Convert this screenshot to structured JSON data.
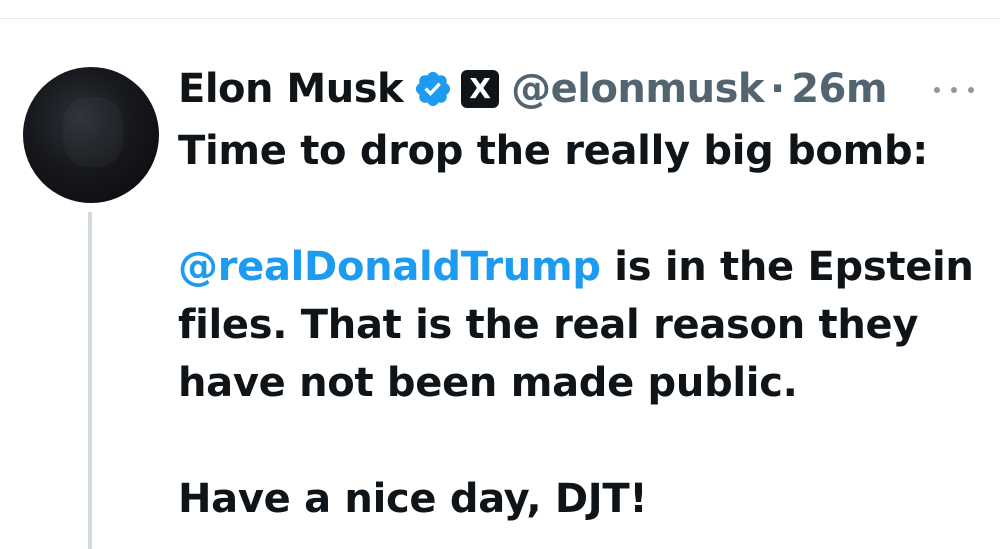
{
  "tweet": {
    "author": {
      "display_name": "Elon Musk",
      "handle": "@elonmusk",
      "verified": true,
      "affiliate_badge": "X"
    },
    "separator": "·",
    "timestamp": "26m",
    "body": {
      "line1": "Time to drop the really big bomb:",
      "mention": "@realDonaldTrump",
      "after_mention": " is in the Epstein files. That is the real reason they have not been made public.",
      "closing": "Have a nice day, DJT!"
    }
  },
  "icons": {
    "verified": "verified-badge-icon",
    "affiliate": "x-logo-icon",
    "more": "more-options-icon"
  },
  "colors": {
    "text": "#0f1419",
    "secondary": "#536471",
    "link": "#1d9bf0",
    "verified": "#1d9bf0",
    "thread_line": "#cfd9de"
  }
}
